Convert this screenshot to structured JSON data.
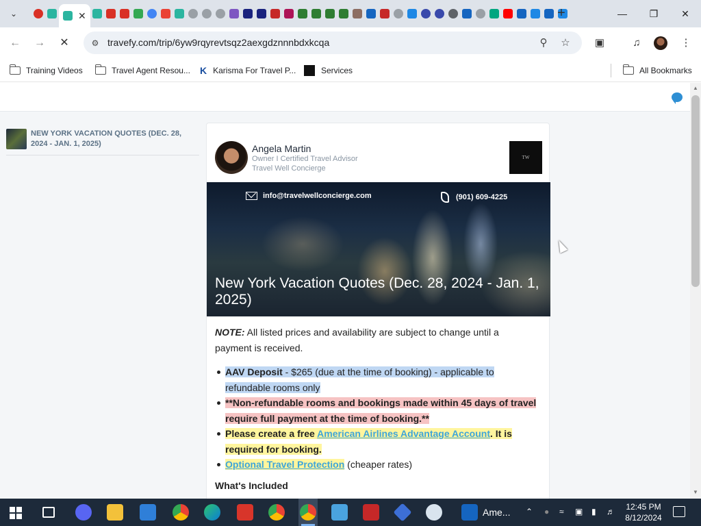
{
  "browser": {
    "url": "travefy.com/trip/6yw9rqyrevtsqz2aexgdznnnbdxkcqa",
    "tab_close": "✕",
    "new_tab": "+",
    "tab_favicons": [
      {
        "icon": "record-icon",
        "color": "#d93025"
      },
      {
        "icon": "arrow-icon",
        "color": "#2bb5a0"
      },
      {
        "icon": "active-tab-icon",
        "color": "#2bb5a0"
      },
      {
        "icon": "arrow-icon",
        "color": "#2bb5a0"
      },
      {
        "icon": "pdf-icon",
        "color": "#d93025"
      },
      {
        "icon": "pdf-icon",
        "color": "#d93025"
      },
      {
        "icon": "maps-icon",
        "color": "#34a853"
      },
      {
        "icon": "chrome-icon",
        "color": "#4285f4"
      },
      {
        "icon": "gmail-icon",
        "color": "#ea4335"
      },
      {
        "icon": "arrow-icon",
        "color": "#2bb5a0"
      },
      {
        "icon": "globe-icon",
        "color": "#9aa0a6"
      },
      {
        "icon": "globe-icon",
        "color": "#9aa0a6"
      },
      {
        "icon": "globe-icon",
        "color": "#9aa0a6"
      },
      {
        "icon": "purple-icon",
        "color": "#7e57c2"
      },
      {
        "icon": "gear-icon",
        "color": "#1a237e"
      },
      {
        "icon": "grid-icon",
        "color": "#1a237e"
      },
      {
        "icon": "r-icon",
        "color": "#c62828"
      },
      {
        "icon": "r-icon",
        "color": "#ad1457"
      },
      {
        "icon": "v-icon",
        "color": "#2e7d32"
      },
      {
        "icon": "v-icon",
        "color": "#2e7d32"
      },
      {
        "icon": "v-icon",
        "color": "#2e7d32"
      },
      {
        "icon": "v-icon",
        "color": "#2e7d32"
      },
      {
        "icon": "ny-icon",
        "color": "#8d6e63"
      },
      {
        "icon": "aav-icon",
        "color": "#1565c0"
      },
      {
        "icon": "vax-icon",
        "color": "#c62828"
      },
      {
        "icon": "globe-icon",
        "color": "#9aa0a6"
      },
      {
        "icon": "plane-icon",
        "color": "#1e88e5"
      },
      {
        "icon": "ring-icon",
        "color": "#3949ab"
      },
      {
        "icon": "ring-icon",
        "color": "#3949ab"
      },
      {
        "icon": "chrome-icon",
        "color": "#5f6368"
      },
      {
        "icon": "grid-icon",
        "color": "#1565c0"
      },
      {
        "icon": "globe-icon",
        "color": "#9aa0a6"
      },
      {
        "icon": "tripadvisor-icon",
        "color": "#00a680"
      },
      {
        "icon": "youtube-icon",
        "color": "#ff0000"
      },
      {
        "icon": "flag-icon",
        "color": "#1565c0"
      },
      {
        "icon": "plane-icon",
        "color": "#1e88e5"
      },
      {
        "icon": "flag-icon",
        "color": "#1565c0"
      },
      {
        "icon": "plane-icon",
        "color": "#1e88e5"
      }
    ]
  },
  "bookmarks": {
    "items": [
      "Training Videos",
      "Travel Agent Resou...",
      "Karisma For Travel P...",
      "Services"
    ],
    "all": "All Bookmarks"
  },
  "sidebar": {
    "trip_title": "NEW YORK VACATION QUOTES (DEC. 28, 2024 - JAN. 1, 2025)"
  },
  "agent": {
    "name": "Angela Martin",
    "role": "Owner I Certified Travel Advisor",
    "company": "Travel Well Concierge",
    "logo_text": "TW"
  },
  "hero": {
    "email": "info@travelwellconcierge.com",
    "phone": "(901) 609-4225",
    "title": "New York Vacation Quotes (Dec. 28, 2024 - Jan. 1, 2025)"
  },
  "content": {
    "note_label": "NOTE:",
    "note_text": " All listed prices and availability are subject to change until a payment is received.",
    "bullet1_bold": "AAV Deposit",
    "bullet1_rest": " - $265 (due at the time of booking) - applicable to refundable rooms only",
    "bullet2": "**Non-refundable rooms and bookings made within 45 days of travel require full payment at the time of booking.**",
    "bullet3_pre": "Please create a free ",
    "bullet3_link": "American Airlines Advantage Account",
    "bullet3_post": ". It is required for booking.",
    "bullet4_link": "Optional Travel Protection",
    "bullet4_rest": " (cheaper rates)",
    "section_heading": "What's Included"
  },
  "taskbar": {
    "app_label": "Ame...",
    "time": "12:45 PM",
    "date": "8/12/2024"
  }
}
